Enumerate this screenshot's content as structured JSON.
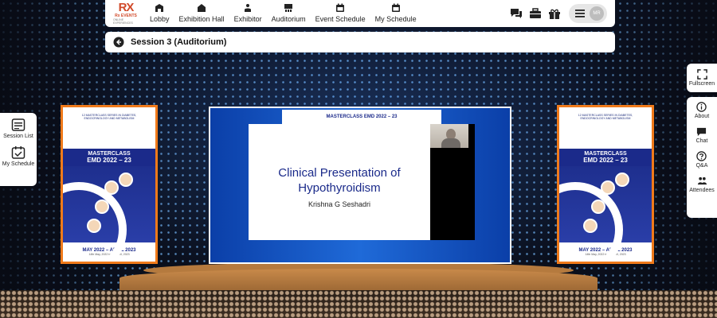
{
  "app": {
    "logo_mark": "RX",
    "logo_text": "Rx EVENTS",
    "logo_sub": "ONLINE EXPERIENCES"
  },
  "nav": {
    "items": [
      {
        "label": "Lobby",
        "icon": "building-icon"
      },
      {
        "label": "Exhibition Hall",
        "icon": "hall-icon"
      },
      {
        "label": "Exhibitor",
        "icon": "exhibitor-icon"
      },
      {
        "label": "Auditorium",
        "icon": "auditorium-icon"
      },
      {
        "label": "Event Schedule",
        "icon": "calendar-icon"
      },
      {
        "label": "My Schedule",
        "icon": "calendar-icon"
      }
    ]
  },
  "topright": {
    "avatar_initials": "MR"
  },
  "session": {
    "title": "Session 3 (Auditorium)"
  },
  "left_panel": {
    "items": [
      {
        "label": "Session List"
      },
      {
        "label": "My Schedule"
      }
    ]
  },
  "right_panel": {
    "fullscreen": "Fullscreen",
    "items": [
      {
        "label": "About"
      },
      {
        "label": "Chat"
      },
      {
        "label": "Q&A"
      },
      {
        "label": "Attendees"
      }
    ]
  },
  "banner": {
    "series": "12 MASTERCLASS SERIES IN DIABETES, ENDOCRINOLOGY AND METABOLISM",
    "masterclass": "MASTERCLASS",
    "emd": "EMD 2022 – 23",
    "dates": "MAY 2022 – APRIL 2023",
    "sub": "14th May, 2022 to 8th April, 2023"
  },
  "screen": {
    "header": "MASTERCLASS EMD 2022 – 23",
    "slide_title_line1": "Clinical Presentation of",
    "slide_title_line2": "Hypothyroidism",
    "slide_author": "Krishna G Seshadri"
  },
  "colors": {
    "accent_orange": "#f07a1a",
    "brand_blue": "#1b2a8a"
  }
}
